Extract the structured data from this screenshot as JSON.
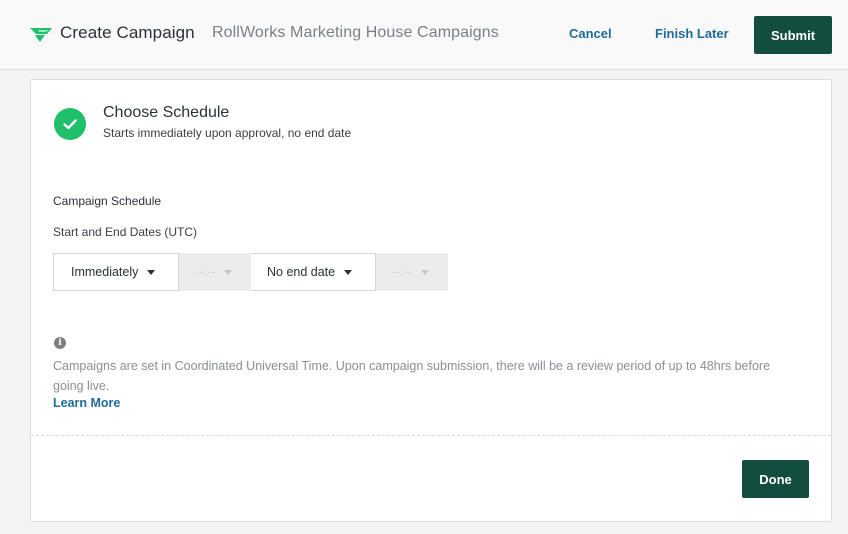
{
  "header": {
    "title": "Create Campaign",
    "subtitle": "RollWorks Marketing House Campaigns",
    "cancel_label": "Cancel",
    "finish_later_label": "Finish Later",
    "submit_label": "Submit",
    "logo_icon": "rollworks-logo-icon"
  },
  "step": {
    "status_icon": "check-icon",
    "title": "Choose Schedule",
    "description": "Starts immediately upon approval, no end date"
  },
  "schedule": {
    "section_label": "Campaign Schedule",
    "dates_label": "Start and End Dates (UTC)",
    "start_select": "Immediately",
    "start_time_placeholder": "--:--",
    "end_select": "No end date",
    "end_time_placeholder": "--:--"
  },
  "info": {
    "icon": "info-icon",
    "text": "Campaigns are set in Coordinated Universal Time. Upon campaign submission, there will be a review period of up to 48hrs before going live.",
    "learn_more": "Learn More"
  },
  "footer": {
    "done_label": "Done"
  },
  "colors": {
    "primary": "#134d40",
    "link": "#1f6b9a",
    "success": "#1fbf6c",
    "logo": "#1fbf6c"
  }
}
